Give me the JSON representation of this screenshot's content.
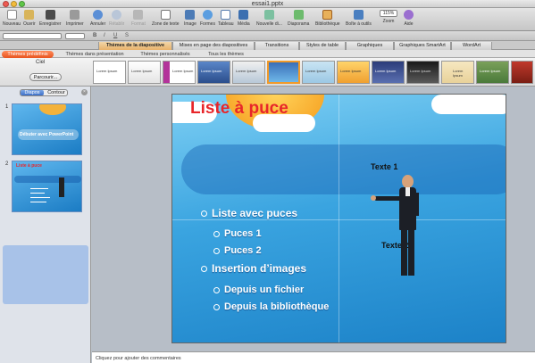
{
  "window": {
    "title": "essai1.pptx"
  },
  "toolbar": {
    "buttons": [
      {
        "label": "Nouveau",
        "icon": "new-document-icon"
      },
      {
        "label": "Ouvrir",
        "icon": "open-folder-icon"
      },
      {
        "label": "Enregistrer",
        "icon": "save-icon"
      },
      {
        "label": "Imprimer",
        "icon": "print-icon"
      },
      {
        "label": "Annuler",
        "icon": "undo-icon"
      },
      {
        "label": "Rétablir",
        "icon": "redo-icon"
      },
      {
        "label": "Format",
        "icon": "format-brush-icon"
      },
      {
        "label": "Zone de texte",
        "icon": "text-box-icon"
      },
      {
        "label": "Image",
        "icon": "image-icon"
      },
      {
        "label": "Formes",
        "icon": "shapes-icon"
      },
      {
        "label": "Tableau",
        "icon": "table-icon"
      },
      {
        "label": "Média",
        "icon": "media-icon"
      },
      {
        "label": "Nouvelle di...",
        "icon": "new-slide-icon"
      },
      {
        "label": "Diaporama",
        "icon": "slideshow-icon"
      },
      {
        "label": "Bibliothèque",
        "icon": "library-icon"
      },
      {
        "label": "Boîte à outils",
        "icon": "toolbox-icon"
      },
      {
        "label": "Zoom",
        "icon": "zoom-icon"
      },
      {
        "label": "Aide",
        "icon": "help-icon"
      }
    ],
    "zoom_value": "115%"
  },
  "ribbon": {
    "tabs": [
      "Thèmes de la diapositive",
      "Mises en page des diapositives",
      "Transitions",
      "Styles de table",
      "Graphiques",
      "Graphiques SmartArt",
      "WordArt"
    ],
    "subtabs": [
      "Thèmes prédéfinis",
      "Thèmes dans présentation",
      "Thèmes personnalisés",
      "Tous les thèmes"
    ],
    "gallery_title": "Ciel",
    "browse_label": "Parcourir...",
    "thumb_label": "Lorem Ipsum"
  },
  "slides_panel": {
    "tabs": [
      "Diapos",
      "Contour"
    ],
    "slides": [
      {
        "number": "1",
        "title": "Débuter avec PowerPoint"
      },
      {
        "number": "2",
        "title": "Liste à puce"
      }
    ]
  },
  "slide": {
    "title": "Liste à puce",
    "bullets": [
      {
        "text": "Liste avec puces",
        "level": 1
      },
      {
        "text": "Puces 1",
        "level": 2
      },
      {
        "text": "Puces 2",
        "level": 2
      },
      {
        "text": "Insertion d’images",
        "level": 1
      },
      {
        "text": "Depuis un fichier",
        "level": 2
      },
      {
        "text": "Depuis la bibliothèque",
        "level": 2
      }
    ],
    "label1": "Texte 1",
    "label2": "Texte 2"
  },
  "notes": {
    "placeholder": "Cliquez pour ajouter des commentaires"
  },
  "colors": {
    "accent_orange": "#e85520",
    "slide_title": "#e8262a",
    "slide_blue": "#3aa4e0"
  }
}
